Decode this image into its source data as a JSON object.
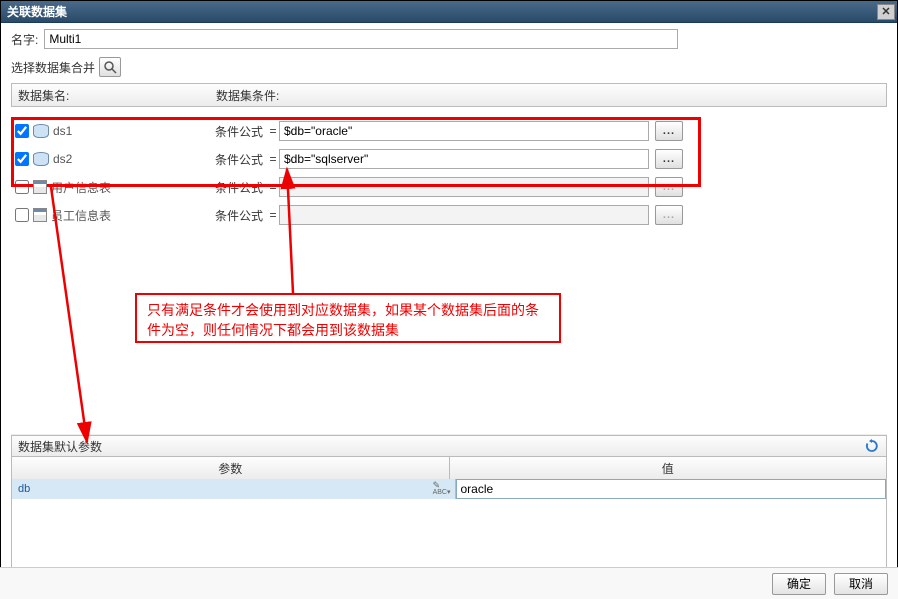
{
  "titlebar": {
    "title": "关联数据集"
  },
  "labels": {
    "name": "名字:",
    "select_merge": "选择数据集合并",
    "dsname_header": "数据集名:",
    "dscond_header": "数据集条件:",
    "formula": "条件公式",
    "eq": "=",
    "dots": "...",
    "default_params": "数据集默认参数",
    "param_col": "参数",
    "value_col": "值",
    "ok": "确定",
    "cancel": "取消"
  },
  "name_value": "Multi1",
  "datasets": [
    {
      "checked": true,
      "icon": "db",
      "label": "ds1",
      "formula": "$db=\"oracle\"",
      "enabled": true
    },
    {
      "checked": true,
      "icon": "db",
      "label": "ds2",
      "formula": "$db=\"sqlserver\"",
      "enabled": true
    },
    {
      "checked": false,
      "icon": "table",
      "label": "用户信息表",
      "formula": "",
      "enabled": false
    },
    {
      "checked": false,
      "icon": "table",
      "label": "员工信息表",
      "formula": "",
      "enabled": false
    }
  ],
  "annotation": "只有满足条件才会使用到对应数据集，如果某个数据集后面的条件为空，则任何情况下都会用到该数据集",
  "params": [
    {
      "name": "db",
      "value": "oracle"
    }
  ]
}
